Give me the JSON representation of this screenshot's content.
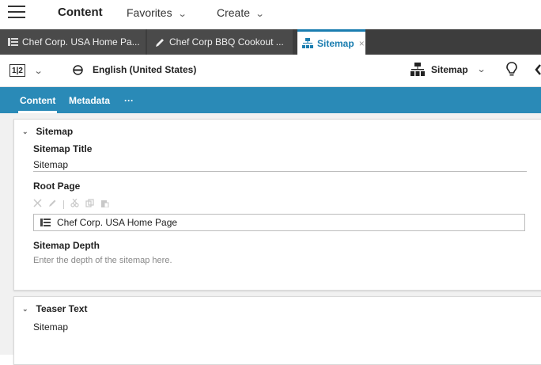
{
  "nav": {
    "title": "Content",
    "favorites": "Favorites",
    "create": "Create"
  },
  "tabs": [
    {
      "label": "Chef Corp. USA Home Pa...",
      "icon": "page-icon"
    },
    {
      "label": "Chef Corp BBQ Cookout ...",
      "icon": "pencil-icon"
    },
    {
      "label": "Sitemap",
      "icon": "sitemap-icon",
      "active": true,
      "close": "×"
    }
  ],
  "toolbar": {
    "view_icon": "split-view-icon",
    "view_label": "1|2",
    "language": "English (United States)",
    "doc_type": "Sitemap"
  },
  "subtabs": [
    {
      "label": "Content",
      "active": true
    },
    {
      "label": "Metadata",
      "active": false
    },
    {
      "label": "···",
      "active": false
    }
  ],
  "sections": {
    "sitemap": {
      "heading": "Sitemap",
      "title_label": "Sitemap Title",
      "title_value": "Sitemap",
      "root_label": "Root Page",
      "root_value": "Chef Corp. USA Home Page",
      "depth_label": "Sitemap Depth",
      "depth_placeholder": "Enter the depth of the sitemap here."
    },
    "teaser": {
      "heading": "Teaser Text",
      "value": "Sitemap"
    }
  },
  "colors": {
    "accent": "#2a8ab7",
    "tab_bar": "#3d3d3d",
    "active_tab_text": "#1a7db0"
  }
}
